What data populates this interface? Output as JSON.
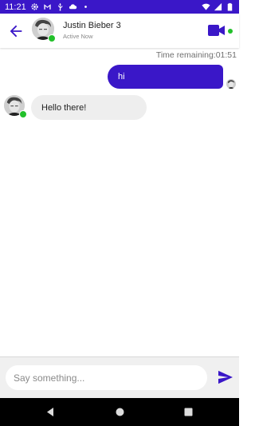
{
  "status_bar": {
    "time": "11:21",
    "icons_left": [
      "gear-icon",
      "gmail-icon",
      "usb-icon",
      "cloud-icon",
      "dot-icon"
    ],
    "icons_right": [
      "wifi-icon",
      "signal-icon",
      "battery-icon"
    ]
  },
  "header": {
    "contact_name": "Justin Bieber 3",
    "contact_status": "Active Now"
  },
  "chat": {
    "timer_text": "Time remaining:01:51",
    "messages": [
      {
        "direction": "sent",
        "text": "hi"
      },
      {
        "direction": "received",
        "text": "Hello there!"
      }
    ]
  },
  "composer": {
    "placeholder": "Say something..."
  },
  "colors": {
    "accent": "#3a17c8",
    "online": "#22c02a",
    "received_bubble": "#eeeeee"
  }
}
